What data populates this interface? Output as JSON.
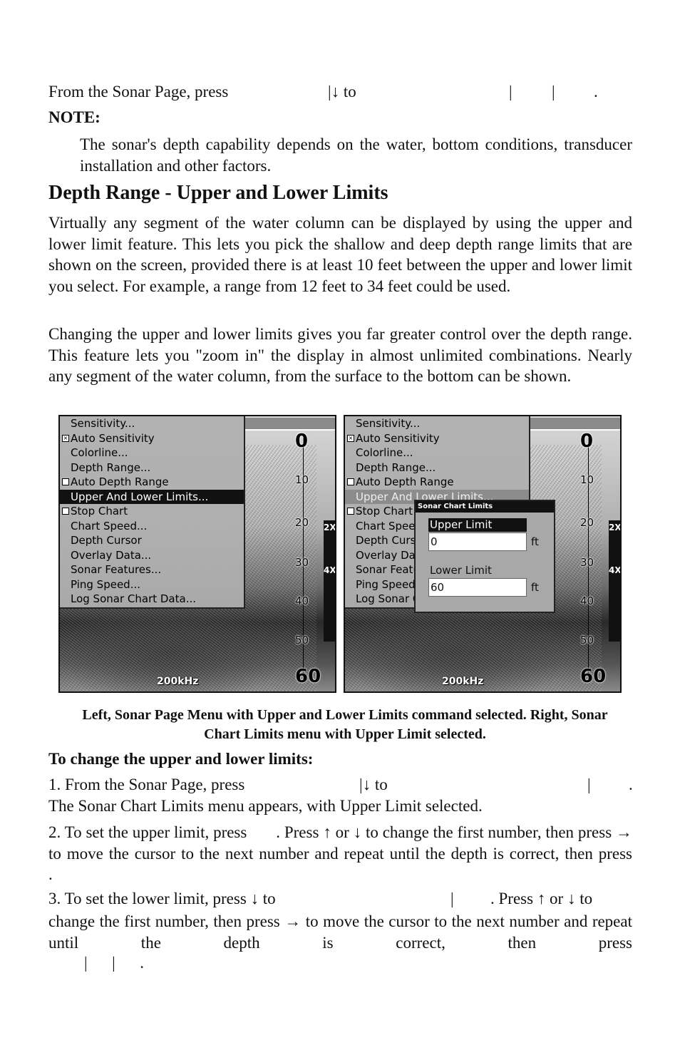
{
  "intro": {
    "l1a": "From the Sonar Page, press",
    "l1b": "|↓ to",
    "l1c": "|",
    "l1d": "|",
    "l1e": ".",
    "note_label": "NOTE:",
    "note_text": "The sonar's depth capability depends on the water, bottom conditions, transducer installation and other factors."
  },
  "section": {
    "title": "Depth Range - Upper and Lower Limits",
    "p1": "Virtually any segment of the water column can be displayed by using the upper and lower limit feature. This lets you pick the shallow and deep depth range limits that are shown on the screen, provided there is at least 10 feet between the upper and lower limit you select. For example, a range from 12 feet to 34 feet could be used.",
    "p2": "Changing the upper and lower limits gives you far greater control over the depth range. This feature lets you \"zoom in\" the display in almost unlimited combinations. Nearly any segment of the water column, from the surface to the bottom can be shown."
  },
  "screens": {
    "menu_items": [
      {
        "label": "Sensitivity...",
        "check": null
      },
      {
        "label": "Auto Sensitivity",
        "check": "checked"
      },
      {
        "label": "Colorline...",
        "check": null
      },
      {
        "label": "Depth Range...",
        "check": null
      },
      {
        "label": "Auto Depth Range",
        "check": "unchecked"
      },
      {
        "label": "Upper And Lower Limits...",
        "check": null
      },
      {
        "label": "Stop Chart",
        "check": "unchecked"
      },
      {
        "label": "Chart Speed...",
        "check": null
      },
      {
        "label": "Depth Cursor",
        "check": null
      },
      {
        "label": "Overlay Data...",
        "check": null
      },
      {
        "label": "Sonar Features...",
        "check": null
      },
      {
        "label": "Ping Speed...",
        "check": null
      },
      {
        "label": "Log Sonar Chart Data...",
        "check": null
      }
    ],
    "depth_labels": [
      "0",
      "10",
      "20",
      "30",
      "40",
      "50",
      "60"
    ],
    "zoom_labels": [
      "2X",
      "4X"
    ],
    "frequency": "200kHz",
    "dialog": {
      "title": "Sonar Chart Limits",
      "upper_label": "Upper Limit",
      "upper_value": "0",
      "lower_label": "Lower Limit",
      "lower_value": "60",
      "unit": "ft"
    }
  },
  "caption": "Left, Sonar Page Menu with Upper and Lower Limits command selected. Right, Sonar Chart Limits menu with Upper Limit selected.",
  "steps": {
    "heading": "To change the upper and lower limits:",
    "s1a": "1. From the Sonar Page, press",
    "s1b": "|↓ to",
    "s1c": "|",
    "s1d": ".",
    "s1e": "The Sonar Chart Limits menu appears, with Upper Limit selected.",
    "s2": "2. To set the upper limit, press       . Press ↑ or ↓ to change the first number, then press → to move the cursor to the next number and repeat until the depth is correct, then press       .",
    "s3a": "3. To set the lower limit, press ↓ to",
    "s3b": "|",
    "s3c": ". Press ↑ or ↓ to",
    "s3d": "change the first number, then press → to move the cursor to the next number and repeat until the depth is correct, then press",
    "s3e": "|      |      ."
  }
}
